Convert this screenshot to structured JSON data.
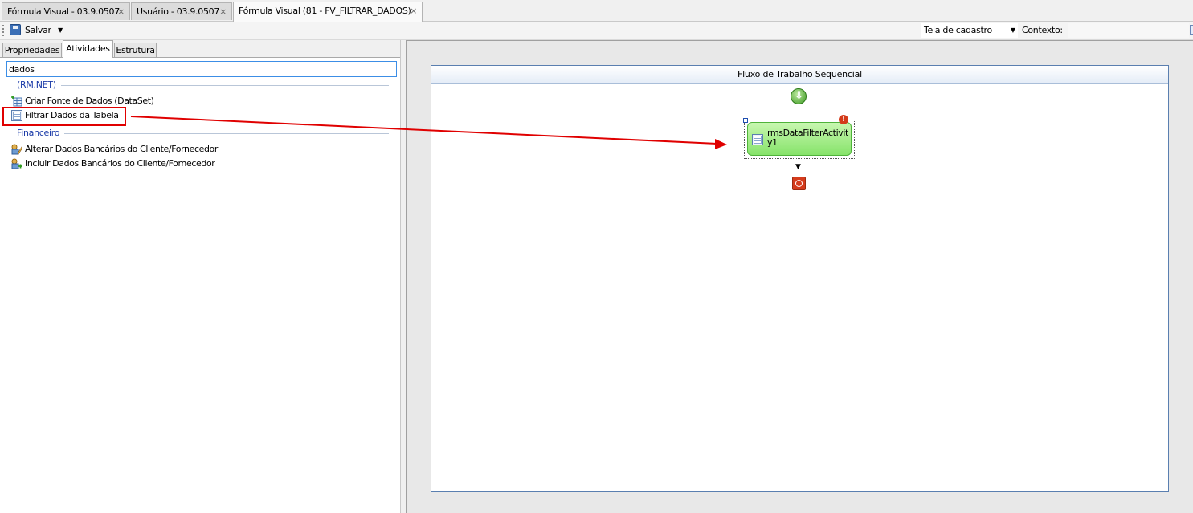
{
  "doc_tabs": [
    {
      "label": "Fórmula Visual - 03.9.0507",
      "active": false
    },
    {
      "label": "Usuário - 03.9.0507",
      "active": false
    },
    {
      "label": "Fórmula Visual (81 - FV_FILTRAR_DADOS)",
      "active": true
    }
  ],
  "close_glyph": "×",
  "toolbar": {
    "save_label": "Salvar",
    "tela_select_value": "Tela de cadastro",
    "contexto_label": "Contexto:"
  },
  "left_panel": {
    "tabs": [
      "Propriedades",
      "Atividades",
      "Estrutura"
    ],
    "active_tab": "Atividades",
    "search_value": "dados",
    "groups": [
      {
        "header": "(RM.NET)",
        "items": [
          {
            "label": "Criar Fonte de Dados (DataSet)",
            "icon": "dataset-add-icon"
          },
          {
            "label": "Filtrar Dados da Tabela",
            "icon": "table-filter-icon"
          }
        ]
      },
      {
        "header": "Financeiro",
        "items": [
          {
            "label": "Alterar Dados Bancários do Cliente/Fornecedor",
            "icon": "bank-edit-icon"
          },
          {
            "label": "Incluir Dados Bancários do Cliente/Fornecedor",
            "icon": "bank-add-icon"
          }
        ]
      }
    ]
  },
  "designer": {
    "workflow_title": "Fluxo de Trabalho Sequencial",
    "activity_label": "rmsDataFilterActivity1",
    "error_glyph": "!",
    "arrow_glyph": "▼"
  },
  "colors": {
    "highlight": "#e00000",
    "group_header": "#1a3aa8",
    "activity_fill": "#86e36a",
    "start": "#3f9a25",
    "end": "#d53b1c"
  }
}
